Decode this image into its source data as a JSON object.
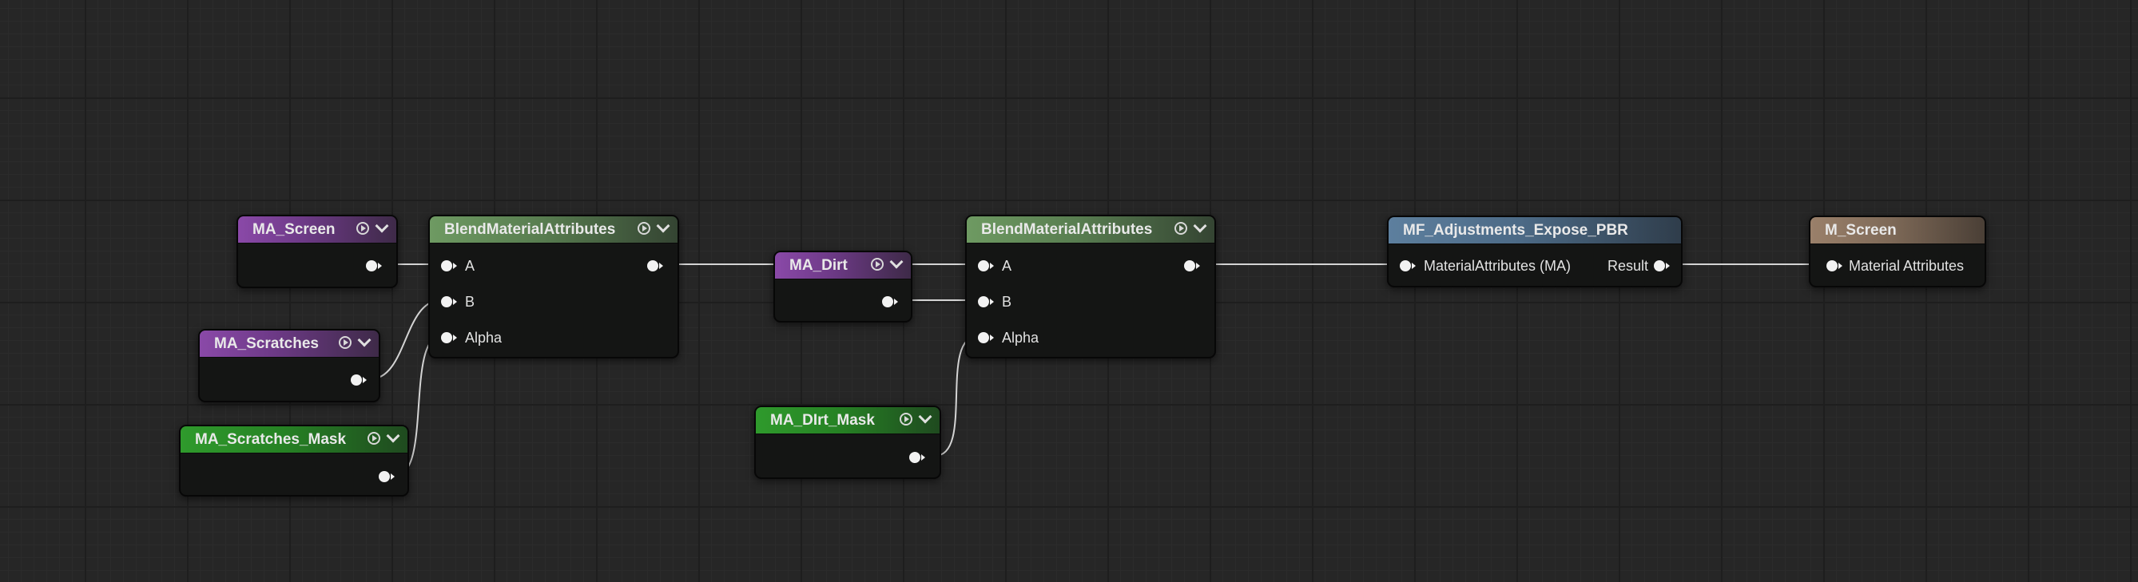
{
  "graph": {
    "nodes": {
      "ma_screen": {
        "title": "MA_Screen"
      },
      "ma_scratches": {
        "title": "MA_Scratches"
      },
      "ma_scratches_mask": {
        "title": "MA_Scratches_Mask"
      },
      "blend1": {
        "title": "BlendMaterialAttributes",
        "pins": {
          "a": "A",
          "b": "B",
          "alpha": "Alpha"
        }
      },
      "ma_dirt": {
        "title": "MA_Dirt"
      },
      "ma_dirt_mask": {
        "title": "MA_DIrt_Mask"
      },
      "blend2": {
        "title": "BlendMaterialAttributes",
        "pins": {
          "a": "A",
          "b": "B",
          "alpha": "Alpha"
        }
      },
      "mf_adjust": {
        "title": "MF_Adjustments_Expose_PBR",
        "pins": {
          "input": "MaterialAttributes (MA)",
          "output": "Result"
        }
      },
      "m_screen": {
        "title": "M_Screen",
        "pins": {
          "input": "Material Attributes"
        }
      }
    },
    "colors": {
      "material_attribute_node": "#8a49a8",
      "mask_node": "#2f9a2c",
      "blend_node": "#6e9a62",
      "function_node": "#5d7f9e",
      "result_node": "#9a806a",
      "wire": "#d9d9d9"
    }
  }
}
